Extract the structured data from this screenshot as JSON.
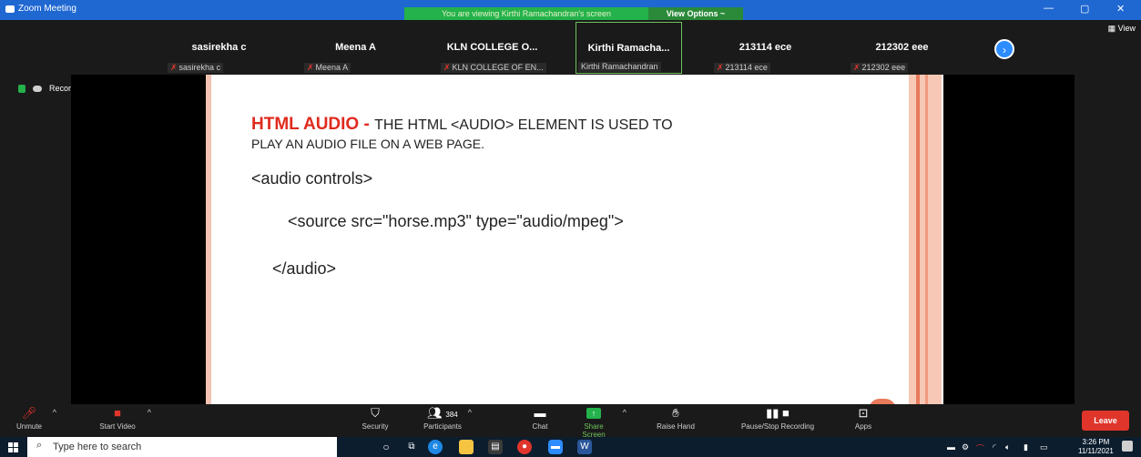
{
  "window": {
    "title": "Zoom Meeting",
    "viewing_banner": "You are viewing Kirthi Ramachandran's screen",
    "view_options": "View Options ~",
    "minimize": "—",
    "restore": "▢",
    "close": "✕",
    "view_label": "View"
  },
  "participants": [
    {
      "name": "sasirekha c",
      "label": "sasirekha c",
      "muted": true,
      "active": false
    },
    {
      "name": "Meena A",
      "label": "Meena A",
      "muted": true,
      "active": false
    },
    {
      "name": "KLN COLLEGE O...",
      "label": "KLN COLLEGE OF EN...",
      "muted": true,
      "active": false
    },
    {
      "name": "Kirthi  Ramacha...",
      "label": "Kirthi Ramachandran",
      "muted": false,
      "active": true
    },
    {
      "name": "213114 ece",
      "label": "213114 ece",
      "muted": true,
      "active": false
    },
    {
      "name": "212302 eee",
      "label": "212302 eee",
      "muted": true,
      "active": false
    }
  ],
  "recording": {
    "label": "Recording..."
  },
  "slide": {
    "heading_red": "HTML AUDIO - ",
    "heading_rest": "THE HTML <AUDIO> ELEMENT IS USED TO",
    "line2": "PLAY AN AUDIO FILE ON A WEB PAGE.",
    "code1": "<audio controls>",
    "code2": "<source src=\"horse.mp3\" type=\"audio/mpeg\">",
    "code3": "</audio>"
  },
  "toolbar": {
    "unmute": "Unmute",
    "start_video": "Start Video",
    "security": "Security",
    "participants": "Participants",
    "participants_count": "384",
    "chat": "Chat",
    "share_screen": "Share Screen",
    "raise_hand": "Raise Hand",
    "pause_recording": "Pause/Stop Recording",
    "apps": "Apps",
    "leave": "Leave"
  },
  "taskbar": {
    "search_placeholder": "Type here to search",
    "time": "3:26 PM",
    "date": "11/11/2021"
  }
}
